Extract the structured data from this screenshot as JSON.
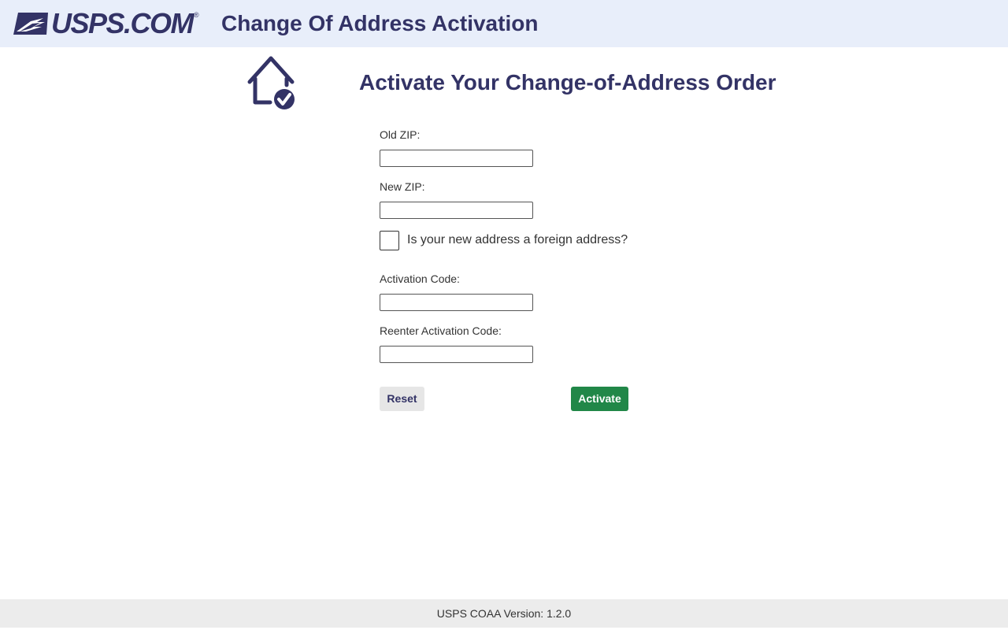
{
  "header": {
    "logo_text": "USPS.COM",
    "logo_reg": "®",
    "title": "Change Of Address Activation"
  },
  "main": {
    "icon": "house-check-icon",
    "title": "Activate Your Change-of-Address Order",
    "form": {
      "old_zip_label": "Old ZIP:",
      "old_zip_value": "",
      "new_zip_label": "New ZIP:",
      "new_zip_value": "",
      "foreign_label": "Is your new address a foreign address?",
      "foreign_checked": false,
      "activation_code_label": "Activation Code:",
      "activation_code_value": "",
      "reenter_code_label": "Reenter Activation Code:",
      "reenter_code_value": ""
    },
    "buttons": {
      "reset_label": "Reset",
      "activate_label": "Activate"
    }
  },
  "footer": {
    "version_text": "USPS COAA Version: 1.2.0"
  },
  "colors": {
    "brand_navy": "#333366",
    "header_bg": "#e8eefa",
    "activate_green": "#218748",
    "reset_bg": "#e6e6e6",
    "footer_bg": "#ececec"
  }
}
